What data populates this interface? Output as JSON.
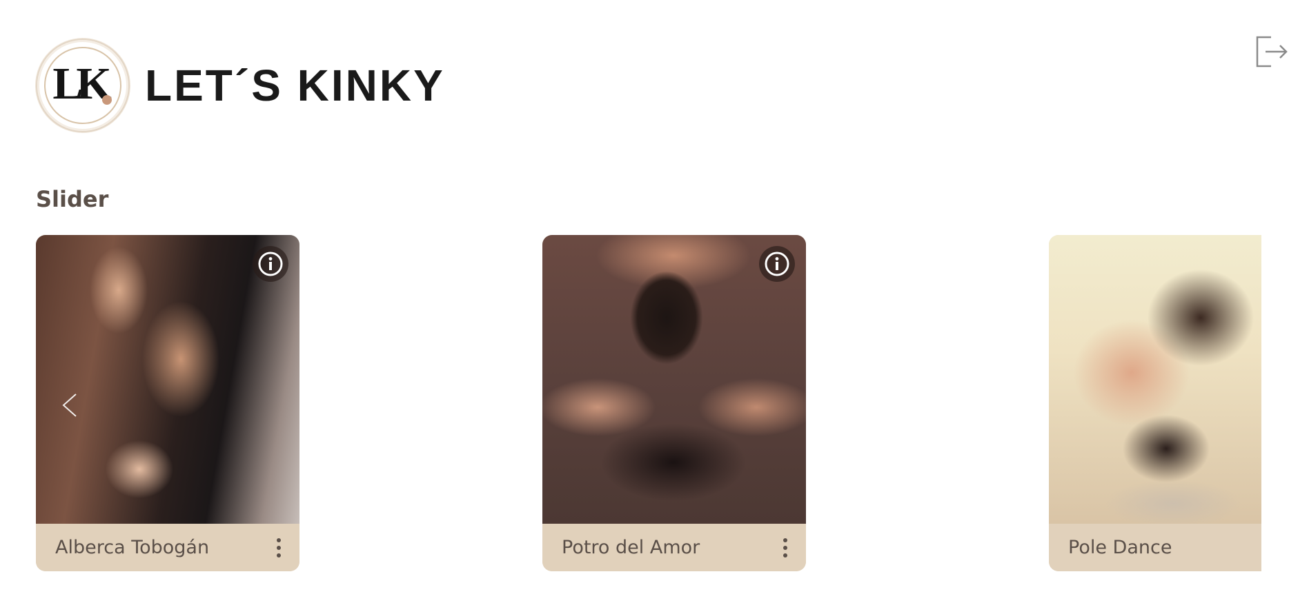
{
  "header": {
    "logo_initials": "LK",
    "logo_text": "LET´S KINKY"
  },
  "section": {
    "title": "Slider"
  },
  "cards": [
    {
      "title": "Alberca Tobogán",
      "image": "couple-by-window"
    },
    {
      "title": "Potro del Amor",
      "image": "couple-on-bed-overhead"
    },
    {
      "title": "Pole Dance",
      "image": "couple-close-up"
    }
  ],
  "colors": {
    "card_footer": "#e1d1bb",
    "text": "#5a4f48",
    "logo_accent": "#c9987a"
  },
  "icons": {
    "logout": "logout-icon",
    "info": "info-icon",
    "more": "kebab-menu-icon",
    "prev": "chevron-left-icon"
  }
}
